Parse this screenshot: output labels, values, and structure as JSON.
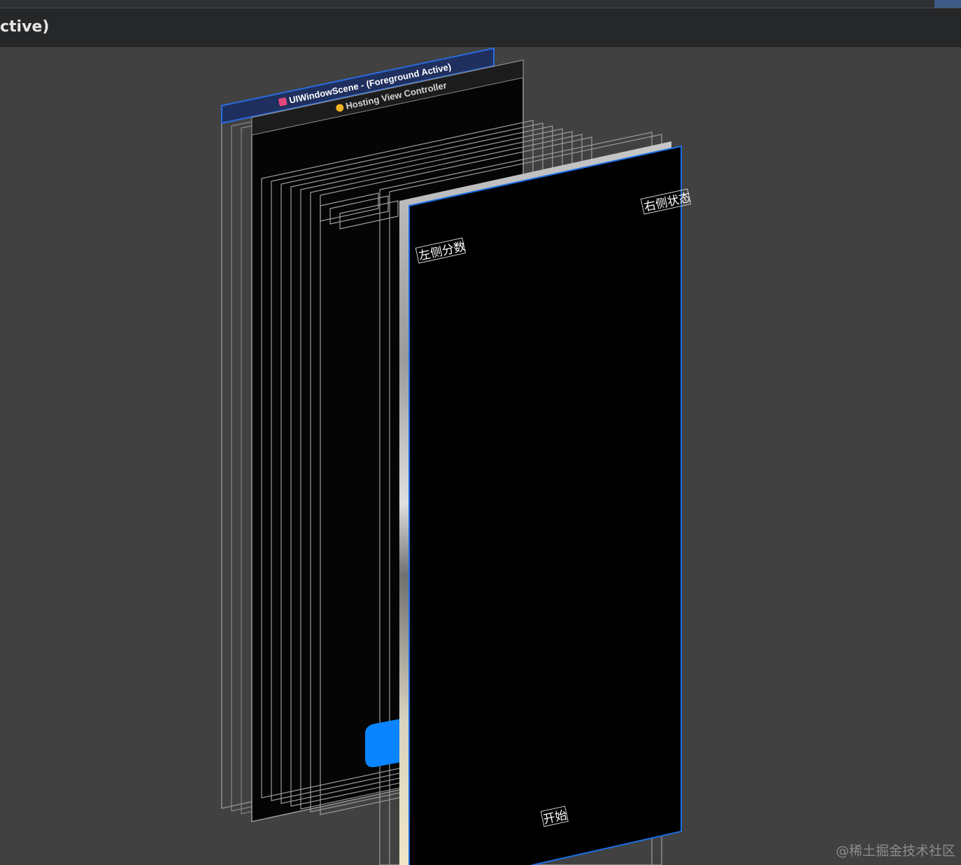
{
  "window": {
    "title": "ctive)"
  },
  "hierarchy": {
    "scene_label": "UIWindowScene - (Foreground Active)",
    "controller_label": "Hosting View Controller"
  },
  "labels": {
    "left_score": "左侧分数",
    "right_status": "右侧状态",
    "start": "开始"
  },
  "colors": {
    "canvas": "#414141",
    "selection_blue": "#1d6fe6",
    "scene_header": "#1f2f5e",
    "button_blue": "#0a84ff",
    "view_fill": "#000000"
  },
  "watermark": "@稀土掘金技术社区"
}
